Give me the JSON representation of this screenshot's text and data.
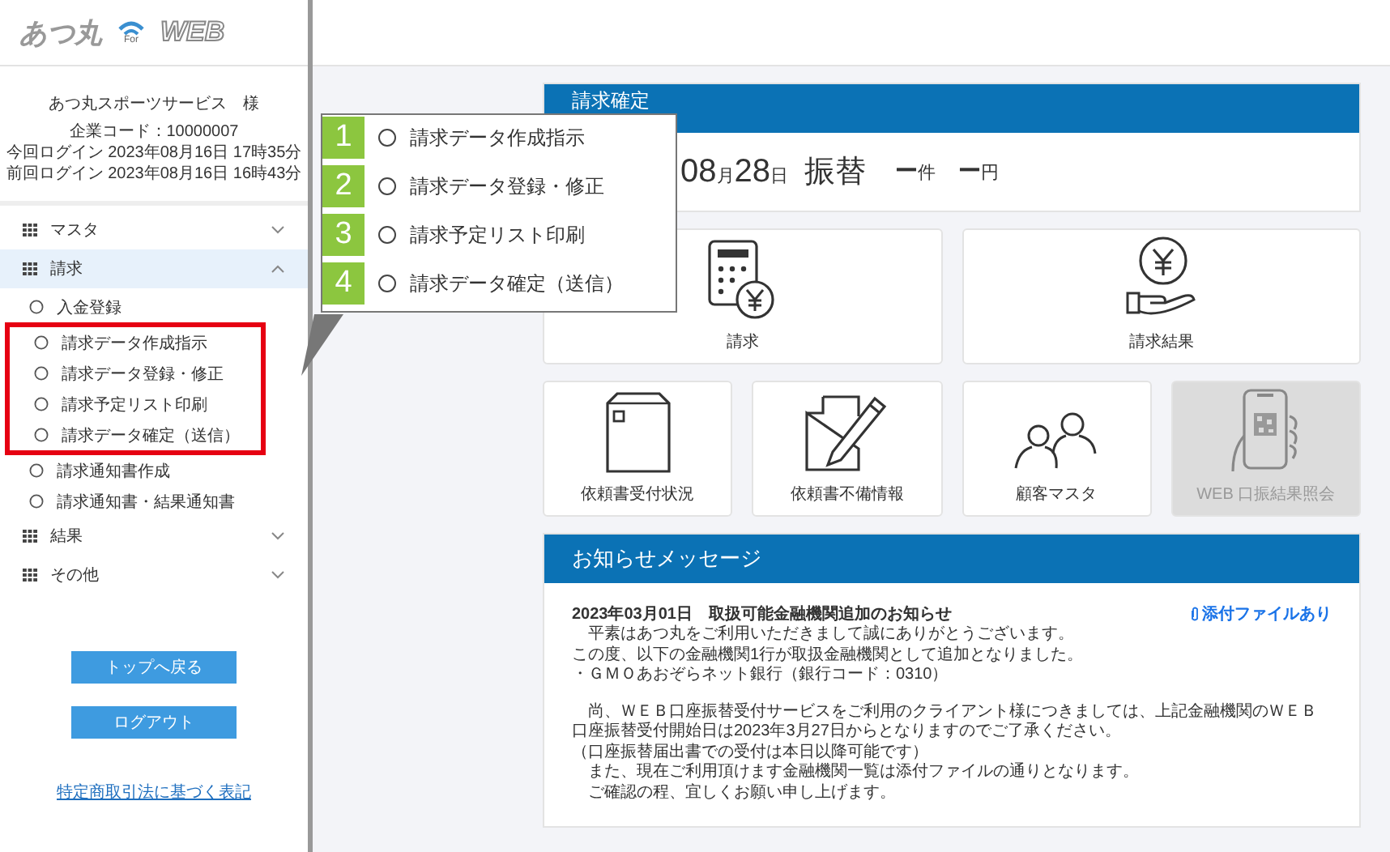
{
  "header": {
    "logo_text": "あつ丸",
    "logo_for": "For",
    "logo_web": "WEB"
  },
  "account": {
    "company": "あつ丸スポーツサービス　様",
    "code": "企業コード：10000007",
    "this_login": "今回ログイン 2023年08月16日 17時35分",
    "last_login": "前回ログイン 2023年08月16日 16時43分"
  },
  "menu": [
    {
      "label": "マスタ",
      "expanded": false
    },
    {
      "label": "請求",
      "expanded": true,
      "children": [
        {
          "label": "入金登録",
          "highlighted": false
        },
        {
          "label": "請求データ作成指示",
          "highlighted": true
        },
        {
          "label": "請求データ登録・修正",
          "highlighted": true
        },
        {
          "label": "請求予定リスト印刷",
          "highlighted": true
        },
        {
          "label": "請求データ確定（送信）",
          "highlighted": true
        },
        {
          "label": "請求通知書作成",
          "highlighted": false
        },
        {
          "label": "請求通知書・結果通知書",
          "highlighted": false
        }
      ]
    },
    {
      "label": "結果",
      "expanded": false
    },
    {
      "label": "その他",
      "expanded": false
    }
  ],
  "buttons": [
    "トップへ戻る",
    "ログアウト"
  ],
  "legal_link": "特定商取引法に基づく表記",
  "callout": {
    "steps": [
      {
        "number": "1",
        "label": "請求データ作成指示"
      },
      {
        "number": "2",
        "label": "請求データ登録・修正"
      },
      {
        "number": "3",
        "label": "請求予定リスト印刷"
      },
      {
        "number": "4",
        "label": "請求データ確定（送信）"
      }
    ]
  },
  "confirm_panel": {
    "title": "請求確定",
    "date": [
      {
        "value": "08",
        "unit": "月"
      },
      {
        "value": "28",
        "unit": "日"
      }
    ],
    "method": "振替",
    "totals": [
      {
        "value": "ー",
        "unit": "件"
      },
      {
        "value": "ー",
        "unit": "円"
      }
    ]
  },
  "tiles": [
    {
      "label": "請求",
      "kind": "calculator",
      "disabled": false
    },
    {
      "label": "請求結果",
      "kind": "payment",
      "disabled": false
    },
    {
      "label": "依頼書受付状況",
      "kind": "envelope",
      "disabled": false
    },
    {
      "label": "依頼書不備情報",
      "kind": "document",
      "disabled": false
    },
    {
      "label": "顧客マスタ",
      "kind": "people",
      "disabled": false
    },
    {
      "label": "WEB 口振結果照会",
      "kind": "phone",
      "disabled": true
    }
  ],
  "notice": {
    "title": "お知らせメッセージ",
    "headline": "2023年03月01日　取扱可能金融機関追加のお知らせ",
    "attachment": "添付ファイルあり",
    "paragraphs": [
      [
        "　平素はあつ丸をご利用いただきまして誠にありがとうございます。",
        "この度、以下の金融機関1行が取扱金融機関として追加となりました。",
        "・ＧＭＯあおぞらネット銀行（銀行コード：0310）"
      ],
      [
        "　尚、ＷＥＢ口座振替受付サービスをご利用のクライアント様につきましては、上記金融機関のＷＥＢ口座振替受付開始日は2023年3月27日からとなりますのでご了承ください。",
        "（口座振替届出書での受付は本日以降可能です）",
        "　また、現在ご利用頂けます金融機関一覧は添付ファイルの通りとなります。",
        "　ご確認の程、宜しくお願い申し上げます。"
      ]
    ]
  }
}
